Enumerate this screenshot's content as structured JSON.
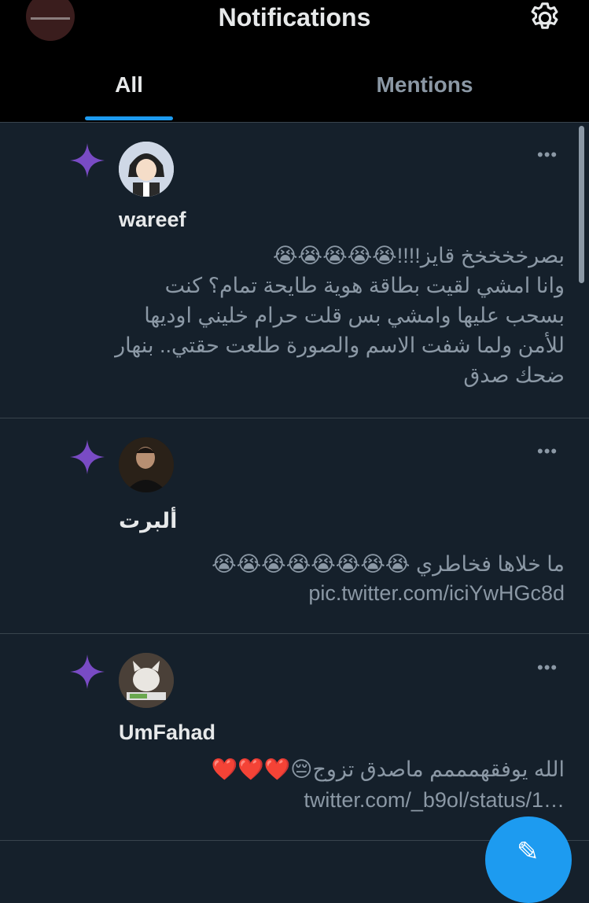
{
  "header": {
    "title": "Notifications",
    "tabs": [
      {
        "label": "All",
        "active": true
      },
      {
        "label": "Mentions",
        "active": false
      }
    ],
    "icons": {
      "settings": "gear-icon"
    }
  },
  "notifications": [
    {
      "icon": "sparkle-icon",
      "name": "wareef",
      "more": "•••",
      "text": "بصرخخخخخ قايز!!!!😭😭😭😭😭\nوانا امشي لقيت بطاقة هوية طايحة تمام؟ كنت بسحب عليها وامشي بس قلت حرام خليني اوديها للأمن ولما شفت الاسم والصورة طلعت حقتي.. بنهار ضحك صدق"
    },
    {
      "icon": "sparkle-icon",
      "name": "ألبرت",
      "more": "•••",
      "text": "ما خلاها فخاطري 😭😭😭😭😭😭😭😭",
      "link": "pic.twitter.com/iciYwHGc8d"
    },
    {
      "icon": "sparkle-icon",
      "name": "UmFahad",
      "more": "•••",
      "text": "الله يوفقهمممم ماصدق تزوج😔❤️❤️❤️",
      "link": "twitter.com/_b9ol/status/1…"
    }
  ],
  "colors": {
    "background": "#15202b",
    "header": "#000000",
    "accent": "#1d9bf0",
    "sparkle": "#794bc4",
    "muted_text": "#8b98a5"
  }
}
